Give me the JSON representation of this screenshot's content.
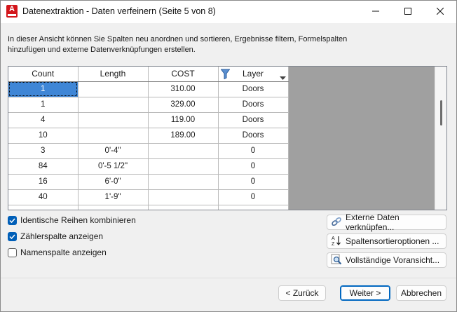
{
  "window": {
    "title": "Datenextraktion - Daten verfeinern (Seite 5 von 8)",
    "app_icon_letter": "A"
  },
  "description": "In dieser Ansicht können Sie Spalten neu anordnen und sortieren, Ergebnisse filtern, Formelspalten hinzufügen und externe Datenverknüpfungen erstellen.",
  "grid": {
    "columns": [
      "Count",
      "Length",
      "COST",
      "Layer"
    ],
    "rows": [
      [
        "1",
        "",
        "310.00",
        "Doors"
      ],
      [
        "1",
        "",
        "329.00",
        "Doors"
      ],
      [
        "4",
        "",
        "119.00",
        "Doors"
      ],
      [
        "10",
        "",
        "189.00",
        "Doors"
      ],
      [
        "3",
        "0'-4\"",
        "",
        "0"
      ],
      [
        "84",
        "0'-5 1/2\"",
        "",
        "0"
      ],
      [
        "16",
        "6'-0\"",
        "",
        "0"
      ],
      [
        "40",
        "1'-9\"",
        "",
        "0"
      ],
      [
        "",
        "",
        "",
        ""
      ]
    ],
    "selected_row": 0,
    "selected_col": 0
  },
  "options": {
    "combine_identical": {
      "label": "Identische Reihen kombinieren",
      "checked": true
    },
    "show_count_column": {
      "label": "Zählerspalte anzeigen",
      "checked": true
    },
    "show_name_column": {
      "label": "Namenspalte anzeigen",
      "checked": false
    }
  },
  "side_buttons": {
    "link_external": "Externe Daten verknüpfen...",
    "sort_options": "Spaltensortieroptionen ...",
    "full_preview": "Vollständige Voransicht..."
  },
  "nav_buttons": {
    "back": "< Zurück",
    "next": "Weiter >",
    "cancel": "Abbrechen"
  }
}
